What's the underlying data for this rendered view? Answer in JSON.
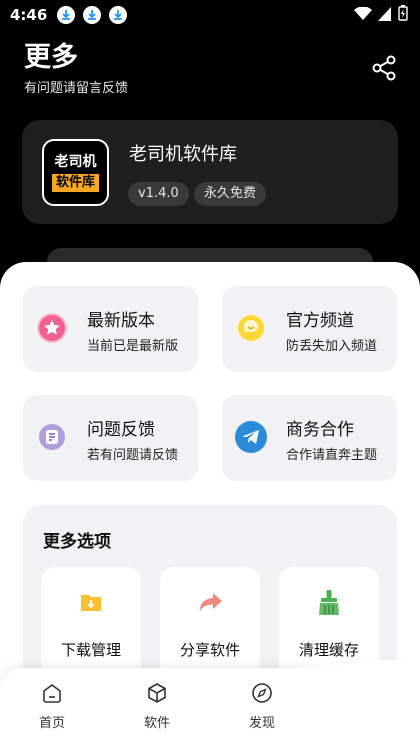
{
  "status": {
    "time": "4:46"
  },
  "header": {
    "title": "更多",
    "subtitle": "有问题请留言反馈"
  },
  "app": {
    "logo_line1": "老司机",
    "logo_line2": "软件库",
    "name": "老司机软件库",
    "version": "v1.4.0",
    "license": "永久免费"
  },
  "tiles": [
    {
      "title": "最新版本",
      "desc": "当前已是最新版",
      "icon": "star-icon",
      "color": "#f06292"
    },
    {
      "title": "官方频道",
      "desc": "防丢失加入频道",
      "icon": "chat-icon",
      "color": "#fbc02d"
    },
    {
      "title": "问题反馈",
      "desc": "若有问题请反馈",
      "icon": "feedback-icon",
      "color": "#7e57c2"
    },
    {
      "title": "商务合作",
      "desc": "合作请直奔主题",
      "icon": "telegram-icon",
      "color": "#2a8bd8"
    }
  ],
  "more": {
    "title": "更多选项",
    "options": [
      {
        "label": "下载管理",
        "icon": "download-folder-icon"
      },
      {
        "label": "分享软件",
        "icon": "share-arrow-icon"
      },
      {
        "label": "清理缓存",
        "icon": "broom-icon"
      }
    ]
  },
  "nav": [
    {
      "label": "首页",
      "icon": "home-icon"
    },
    {
      "label": "软件",
      "icon": "cube-icon"
    },
    {
      "label": "发现",
      "icon": "compass-icon"
    }
  ]
}
